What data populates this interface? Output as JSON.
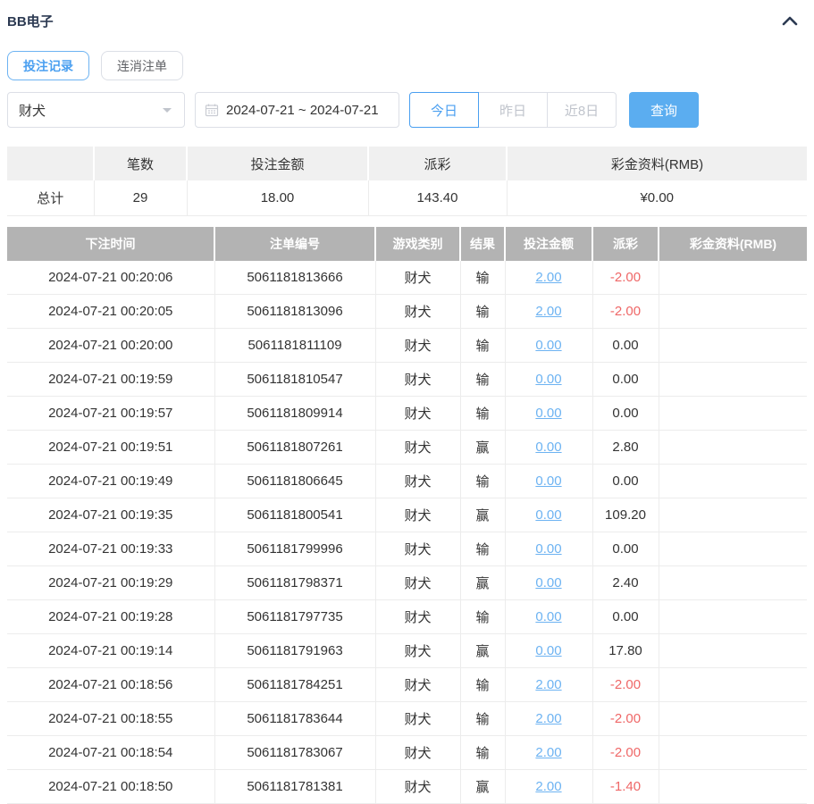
{
  "colors": {
    "accent_blue": "#4a9ff0",
    "button_blue": "#5badf0",
    "link_blue": "#6db3f2",
    "negative_red": "#ef6767",
    "table_header_gray": "#b3b3b3",
    "summary_header_gray": "#f0f0f0"
  },
  "panel": {
    "title": "BB电子"
  },
  "tabs": [
    {
      "label": "投注记录",
      "active": true
    },
    {
      "label": "连消注单",
      "active": false
    }
  ],
  "filters": {
    "game_select": {
      "value": "财犬"
    },
    "date_range": {
      "value": "2024-07-21 ~ 2024-07-21"
    },
    "quick_buttons": [
      {
        "label": "今日",
        "active": true
      },
      {
        "label": "昨日",
        "active": false
      },
      {
        "label": "近8日",
        "active": false
      }
    ],
    "query_label": "查询"
  },
  "summary": {
    "headers": [
      "",
      "笔数",
      "投注金额",
      "派彩",
      "彩金资料(RMB)"
    ],
    "row": {
      "label": "总计",
      "count": "29",
      "bet_amount": "18.00",
      "payout": "143.40",
      "bonus": "¥0.00"
    }
  },
  "table": {
    "headers": [
      "下注时间",
      "注单编号",
      "游戏类别",
      "结果",
      "投注金额",
      "派彩",
      "彩金资料(RMB)"
    ],
    "rows": [
      {
        "time": "2024-07-21 00:20:06",
        "bet_id": "5061181813666",
        "game": "财犬",
        "result": "输",
        "amount": "2.00",
        "payout": "-2.00",
        "bonus": ""
      },
      {
        "time": "2024-07-21 00:20:05",
        "bet_id": "5061181813096",
        "game": "财犬",
        "result": "输",
        "amount": "2.00",
        "payout": "-2.00",
        "bonus": ""
      },
      {
        "time": "2024-07-21 00:20:00",
        "bet_id": "5061181811109",
        "game": "财犬",
        "result": "输",
        "amount": "0.00",
        "payout": "0.00",
        "bonus": ""
      },
      {
        "time": "2024-07-21 00:19:59",
        "bet_id": "5061181810547",
        "game": "财犬",
        "result": "输",
        "amount": "0.00",
        "payout": "0.00",
        "bonus": ""
      },
      {
        "time": "2024-07-21 00:19:57",
        "bet_id": "5061181809914",
        "game": "财犬",
        "result": "输",
        "amount": "0.00",
        "payout": "0.00",
        "bonus": ""
      },
      {
        "time": "2024-07-21 00:19:51",
        "bet_id": "5061181807261",
        "game": "财犬",
        "result": "赢",
        "amount": "0.00",
        "payout": "2.80",
        "bonus": ""
      },
      {
        "time": "2024-07-21 00:19:49",
        "bet_id": "5061181806645",
        "game": "财犬",
        "result": "输",
        "amount": "0.00",
        "payout": "0.00",
        "bonus": ""
      },
      {
        "time": "2024-07-21 00:19:35",
        "bet_id": "5061181800541",
        "game": "财犬",
        "result": "赢",
        "amount": "0.00",
        "payout": "109.20",
        "bonus": ""
      },
      {
        "time": "2024-07-21 00:19:33",
        "bet_id": "5061181799996",
        "game": "财犬",
        "result": "输",
        "amount": "0.00",
        "payout": "0.00",
        "bonus": ""
      },
      {
        "time": "2024-07-21 00:19:29",
        "bet_id": "5061181798371",
        "game": "财犬",
        "result": "赢",
        "amount": "0.00",
        "payout": "2.40",
        "bonus": ""
      },
      {
        "time": "2024-07-21 00:19:28",
        "bet_id": "5061181797735",
        "game": "财犬",
        "result": "输",
        "amount": "0.00",
        "payout": "0.00",
        "bonus": ""
      },
      {
        "time": "2024-07-21 00:19:14",
        "bet_id": "5061181791963",
        "game": "财犬",
        "result": "赢",
        "amount": "0.00",
        "payout": "17.80",
        "bonus": ""
      },
      {
        "time": "2024-07-21 00:18:56",
        "bet_id": "5061181784251",
        "game": "财犬",
        "result": "输",
        "amount": "2.00",
        "payout": "-2.00",
        "bonus": ""
      },
      {
        "time": "2024-07-21 00:18:55",
        "bet_id": "5061181783644",
        "game": "财犬",
        "result": "输",
        "amount": "2.00",
        "payout": "-2.00",
        "bonus": ""
      },
      {
        "time": "2024-07-21 00:18:54",
        "bet_id": "5061181783067",
        "game": "财犬",
        "result": "输",
        "amount": "2.00",
        "payout": "-2.00",
        "bonus": ""
      },
      {
        "time": "2024-07-21 00:18:50",
        "bet_id": "5061181781381",
        "game": "财犬",
        "result": "赢",
        "amount": "2.00",
        "payout": "-1.40",
        "bonus": ""
      }
    ]
  }
}
